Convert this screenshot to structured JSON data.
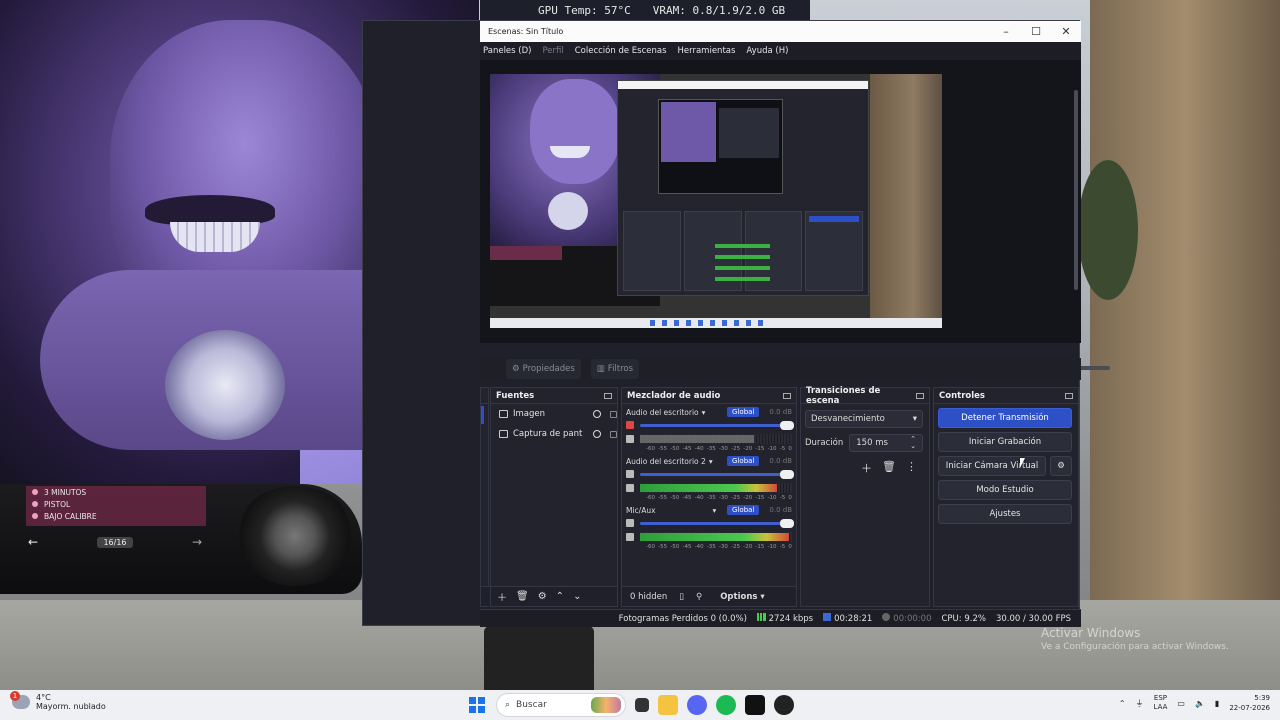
{
  "osd": {
    "gpu_temp": "GPU Temp: 57°C",
    "vram": "VRAM: 0.8/1.9/2.0 GB"
  },
  "gta": {
    "items": [
      "3 MINUTOS",
      "PISTOL",
      "BAJO CALIBRE"
    ],
    "pager": "16/16",
    "prev_icon": "arrow-left-icon",
    "next_icon": "arrow-right-icon"
  },
  "obs": {
    "window_title": "Escenas: Sin Título",
    "window_controls": [
      "–",
      "☐",
      "✕"
    ],
    "menu": [
      "Paneles (D)",
      "Perfil",
      "Colección de Escenas",
      "Herramientas",
      "Ayuda (H)"
    ],
    "menu_disabled": "Perfil",
    "toolbar": {
      "properties": "Propiedades",
      "filters": "Filtros"
    },
    "sources": {
      "title": "Fuentes",
      "items": [
        {
          "name": "Imagen",
          "icon": "image-icon"
        },
        {
          "name": "Captura de pant",
          "icon": "monitor-icon"
        }
      ]
    },
    "mixer": {
      "title": "Mezclador de audio",
      "channels": [
        {
          "name": "Audio del escritorio",
          "global": "Global",
          "db": "0.0 dB",
          "muted": true,
          "level": 0.75,
          "meter": "gray"
        },
        {
          "name": "Audio del escritorio 2",
          "global": "Global",
          "db": "0.0 dB",
          "muted": false,
          "level": 0.9,
          "meter": "green"
        },
        {
          "name": "Mic/Aux",
          "global": "Global",
          "db": "0.0 dB",
          "muted": false,
          "level": 0.98,
          "meter": "green"
        }
      ],
      "scale": [
        "-60",
        "-55",
        "-50",
        "-45",
        "-40",
        "-35",
        "-30",
        "-25",
        "-20",
        "-15",
        "-10",
        "-5",
        "0"
      ],
      "hidden": "0 hidden",
      "options": "Options"
    },
    "transitions": {
      "title": "Transiciones de escena",
      "selected": "Desvanecimiento",
      "duration_label": "Duración",
      "duration_value": "150 ms"
    },
    "controls": {
      "title": "Controles",
      "stop_stream": "Detener Transmisión",
      "start_record": "Iniciar Grabación",
      "start_vcam": "Iniciar Cámara Virtual",
      "studio_mode": "Modo Estudio",
      "settings": "Ajustes"
    },
    "status": {
      "dropped": "Fotogramas Perdidos 0 (0.0%)",
      "bitrate": "2724 kbps",
      "stream_time": "00:28:21",
      "record_time": "00:00:00",
      "cpu": "CPU: 9.2%",
      "fps": "30.00 / 30.00 FPS"
    }
  },
  "watermark": {
    "title": "Activar Windows",
    "subtitle": "Ve a Configuración para activar Windows."
  },
  "taskbar": {
    "temp": "4°C",
    "weather": "Mayorm. nublado",
    "badge": "1",
    "search_placeholder": "Buscar",
    "lang_top": "ESP",
    "lang_bottom": "LAA",
    "time": "5:39",
    "date": "22-07-2026"
  }
}
